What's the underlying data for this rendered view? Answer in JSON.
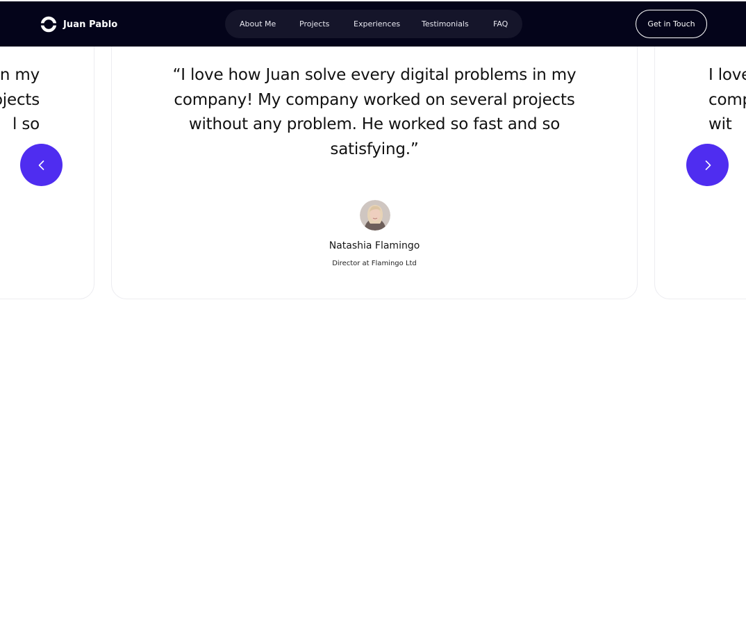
{
  "nav": {
    "brand": "Juan Pablo",
    "links": [
      "About Me",
      "Projects",
      "Experiences",
      "Testimonials",
      "FAQ"
    ],
    "cta": "Get in Touch"
  },
  "testimonials": {
    "prev": {
      "quote_lines": [
        "n my",
        "ojects",
        "l so"
      ]
    },
    "current": {
      "quote_lines": [
        "“I love how Juan solve every digital problems in my",
        "company! My company worked on several projects",
        "without any problem. He worked so fast and so",
        "satisfying.”"
      ],
      "author": "Natashia Flamingo",
      "role": "Director at Flamingo Ltd"
    },
    "next": {
      "quote_lines": [
        "I love",
        "comp",
        "wit"
      ]
    },
    "prev_button_icon": "chevron-left-icon",
    "next_button_icon": "chevron-right-icon"
  },
  "colors": {
    "nav_bg": "#04041a",
    "nav_pill_bg": "#15152a",
    "accent": "#4f2df0"
  }
}
